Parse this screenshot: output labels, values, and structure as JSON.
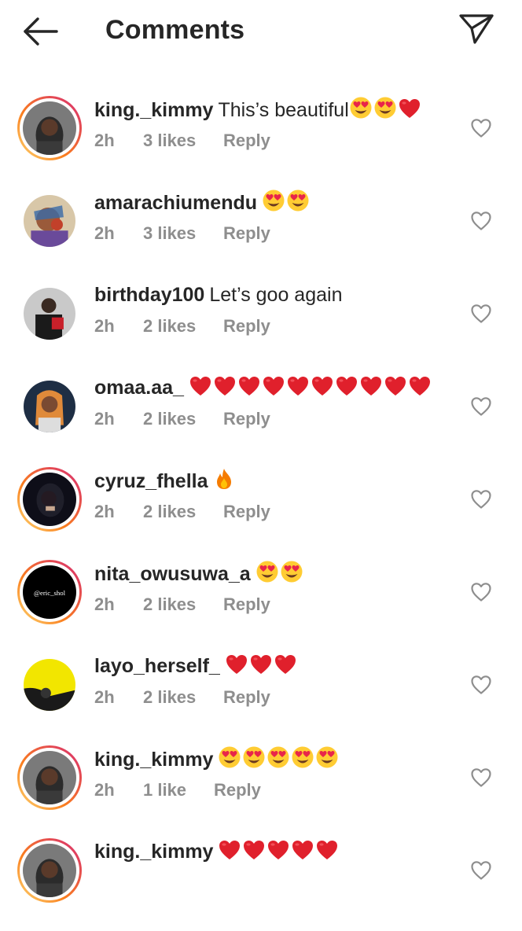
{
  "header": {
    "title": "Comments"
  },
  "comments": [
    {
      "username": "king._kimmy",
      "text": "This’s beautiful",
      "emojis": [
        "heart-eyes",
        "heart-eyes",
        "heart"
      ],
      "time": "2h",
      "likes": "3 likes",
      "reply": "Reply",
      "story": true
    },
    {
      "username": "amarachiumendu",
      "text": "",
      "emojis": [
        "heart-eyes",
        "heart-eyes"
      ],
      "time": "2h",
      "likes": "3 likes",
      "reply": "Reply",
      "story": false
    },
    {
      "username": "birthday100",
      "text": "Let’s goo again",
      "emojis": [],
      "time": "2h",
      "likes": "2 likes",
      "reply": "Reply",
      "story": false
    },
    {
      "username": "omaa.aa_",
      "text": "",
      "emojis": [
        "heart",
        "heart",
        "heart",
        "heart",
        "heart",
        "heart",
        "heart",
        "heart",
        "heart",
        "heart"
      ],
      "time": "2h",
      "likes": "2 likes",
      "reply": "Reply",
      "story": false
    },
    {
      "username": "cyruz_fhella",
      "text": "",
      "emojis": [
        "fire"
      ],
      "time": "2h",
      "likes": "2 likes",
      "reply": "Reply",
      "story": true
    },
    {
      "username": "nita_owusuwa_a",
      "text": "",
      "emojis": [
        "heart-eyes",
        "heart-eyes"
      ],
      "time": "2h",
      "likes": "2 likes",
      "reply": "Reply",
      "story": true,
      "avatar_text": "@eric_shol"
    },
    {
      "username": "layo_herself_",
      "text": "",
      "emojis": [
        "heart",
        "heart",
        "heart"
      ],
      "time": "2h",
      "likes": "2 likes",
      "reply": "Reply",
      "story": false
    },
    {
      "username": "king._kimmy",
      "text": "",
      "emojis": [
        "heart-eyes",
        "heart-eyes",
        "heart-eyes",
        "heart-eyes",
        "heart-eyes"
      ],
      "time": "2h",
      "likes": "1 like",
      "reply": "Reply",
      "story": true
    },
    {
      "username": "king._kimmy",
      "text": "",
      "emojis": [
        "heart",
        "heart",
        "heart",
        "heart",
        "heart"
      ],
      "time": "",
      "likes": "",
      "reply": "",
      "story": true
    }
  ],
  "colors": {
    "text": "#262626",
    "muted": "#8e8e8e",
    "heart": "#e0202c",
    "story_ring_start": "#d62976",
    "story_ring_end": "#feda75"
  },
  "icons": {
    "back": "arrow-left-icon",
    "share": "paper-plane-icon",
    "like": "heart-outline-icon"
  }
}
